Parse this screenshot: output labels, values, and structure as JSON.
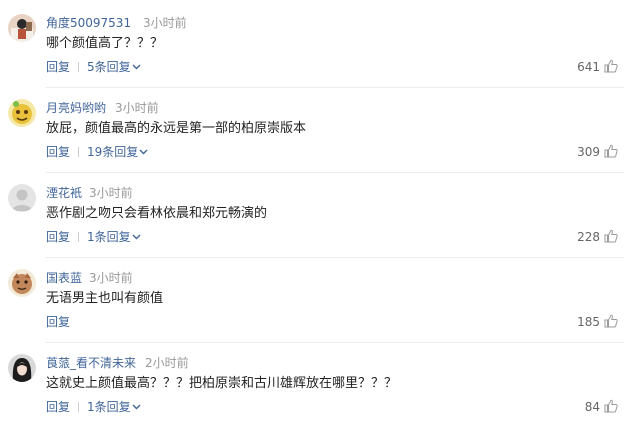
{
  "comments": [
    {
      "username": "角度50097531",
      "time": "3小时前",
      "content": "哪个颜值高了？？？",
      "reply_label": "回复",
      "replies_label": "5条回复",
      "likes": "641"
    },
    {
      "username": "月亮妈哟哟",
      "time": "3小时前",
      "content": "放屁，颜值最高的永远是第一部的柏原崇版本",
      "reply_label": "回复",
      "replies_label": "19条回复",
      "likes": "309"
    },
    {
      "username": "湮花衹",
      "time": "3小时前",
      "content": "恶作剧之吻只会看林依晨和郑元畅演的",
      "reply_label": "回复",
      "replies_label": "1条回复",
      "likes": "228"
    },
    {
      "username": "国表蓝",
      "time": "3小时前",
      "content": "无语男主也叫有颜值",
      "reply_label": "回复",
      "replies_label": "",
      "likes": "185"
    },
    {
      "username": "莨蒎_看不清未来",
      "time": "2小时前",
      "content": "这就史上颜值最高？？？把柏原崇和古川雄辉放在哪里？？？",
      "reply_label": "回复",
      "replies_label": "1条回复",
      "likes": "84"
    }
  ],
  "icons": {
    "chevron": "chevron-down-icon",
    "like": "thumbs-up-icon"
  },
  "colors": {
    "username": "#406599",
    "link": "#406599",
    "meta": "#999999",
    "text": "#222222",
    "divider": "#ececec"
  }
}
